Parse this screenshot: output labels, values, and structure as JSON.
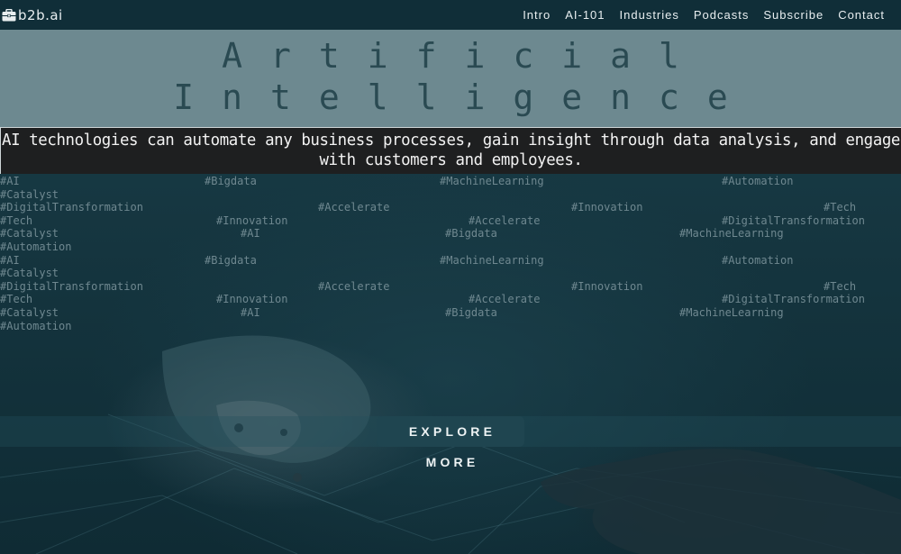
{
  "brand": {
    "name": "b2b.ai",
    "icon": "briefcase-icon"
  },
  "nav": [
    {
      "label": "Intro"
    },
    {
      "label": "AI-101"
    },
    {
      "label": "Industries"
    },
    {
      "label": "Podcasts"
    },
    {
      "label": "Subscribe"
    },
    {
      "label": "Contact"
    }
  ],
  "hero": {
    "line1": "Artificial",
    "line2": "Intelligence"
  },
  "tagline": "AI technologies can automate any business processes, gain insight through data analysis, and engage with customers and employees.",
  "tags": [
    [
      "#AI",
      "#Bigdata",
      "#MachineLearning",
      "#Automation"
    ],
    [
      "#Catalyst"
    ],
    [
      "#DigitalTransformation",
      "#Accelerate",
      "#Innovation",
      "#Tech"
    ],
    [
      "#Tech",
      "#Innovation",
      "#Accelerate",
      "#DigitalTransformation"
    ],
    [
      "#Catalyst",
      "#AI",
      "#Bigdata",
      "#MachineLearning"
    ],
    [
      "#Automation"
    ],
    [
      "#AI",
      "#Bigdata",
      "#MachineLearning",
      "#Automation"
    ],
    [
      "#Catalyst"
    ],
    [
      "#DigitalTransformation",
      "#Accelerate",
      "#Innovation",
      "#Tech"
    ],
    [
      "#Tech",
      "#Innovation",
      "#Accelerate",
      "#DigitalTransformation"
    ],
    [
      "#Catalyst",
      "#AI",
      "#Bigdata",
      "#MachineLearning"
    ],
    [
      "#Automation"
    ]
  ],
  "cta": {
    "label": "EXPLORE MORE"
  },
  "colors": {
    "nav_bg": "#102e38",
    "title_band": "#6d8990",
    "title_text": "#2a4a52",
    "tagline_bg": "#1e1f20",
    "tag_text": "#6f8890",
    "button_bg": "#1f4550"
  }
}
